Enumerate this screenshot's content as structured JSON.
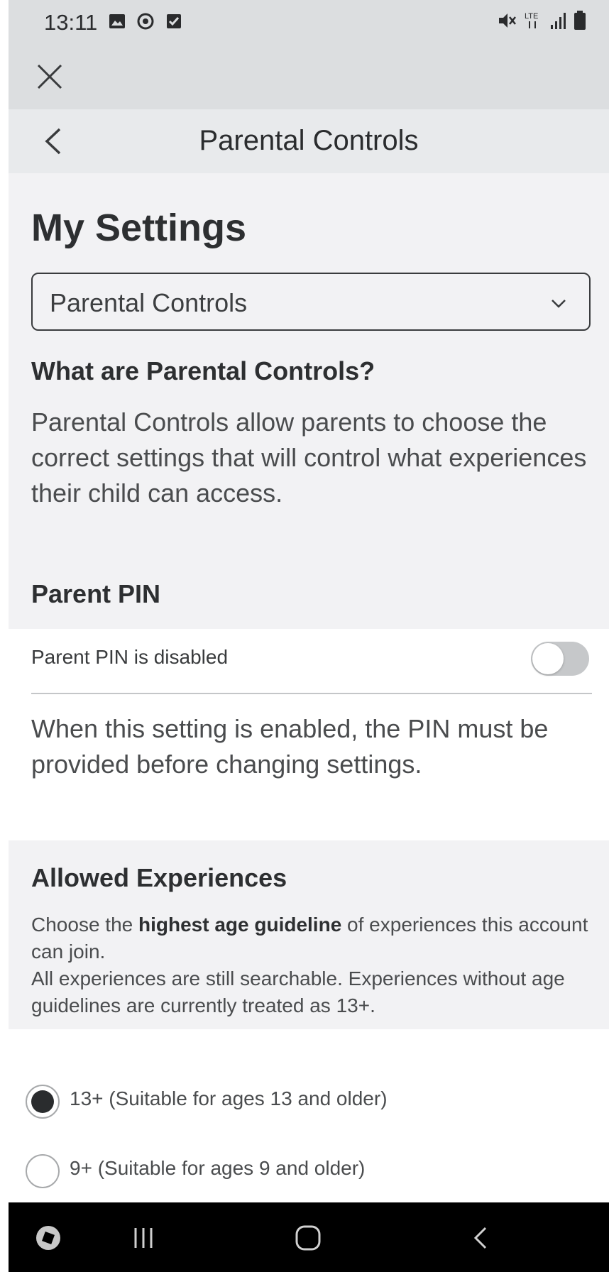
{
  "status_bar": {
    "time": "13:11",
    "left_icons": [
      "image-icon",
      "sync-icon",
      "checkbox-icon"
    ],
    "right_icons": [
      "mute-icon",
      "lte-icon",
      "signal-icon",
      "battery-icon"
    ],
    "lte_label": "LTE"
  },
  "webview": {
    "close_icon": "close-icon"
  },
  "nav": {
    "title": "Parental Controls",
    "back_icon": "chevron-left-icon"
  },
  "settings": {
    "page_title": "My Settings",
    "category_select": {
      "value": "Parental Controls",
      "icon": "chevron-down-icon"
    },
    "what_heading": "What are Parental Controls?",
    "what_description": "Parental Controls allow parents to choose the correct settings that will control what experiences their child can access.",
    "pin_heading": "Parent PIN"
  },
  "pin": {
    "label": "Parent PIN is disabled",
    "enabled": false,
    "description": "When this setting is enabled, the PIN must be provided before changing settings."
  },
  "allowed": {
    "heading": "Allowed Experiences",
    "desc_prefix": "Choose the ",
    "desc_bold": "highest age guideline",
    "desc_suffix": " of experiences this account can join.",
    "desc_line2": "All experiences are still searchable. Experiences without age guidelines are currently treated as 13+.",
    "options": [
      {
        "label": "13+ (Suitable for ages 13 and older)",
        "selected": true
      },
      {
        "label": "9+ (Suitable for ages 9 and older)",
        "selected": false
      }
    ]
  },
  "bottom_nav": {
    "icons": [
      "app-badge-icon",
      "recents-icon",
      "home-icon",
      "back-icon"
    ]
  },
  "colors": {
    "status_bg": "#dcdee0",
    "nav_bg": "#e8eaec",
    "section_bg": "#f2f2f4",
    "toggle_off": "#c6c8ca",
    "radio_selected": "#2a2c2e",
    "bottom_bar": "#000000"
  }
}
